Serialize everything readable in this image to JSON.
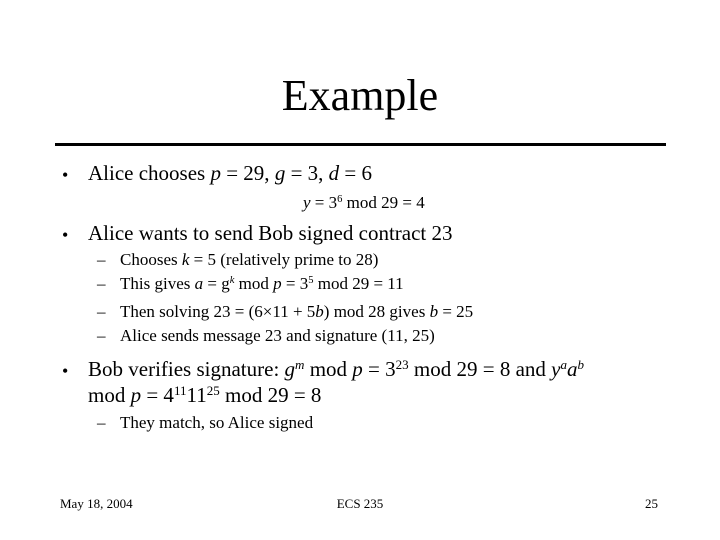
{
  "slide": {
    "title": "Example",
    "bullets": [
      {
        "segments": [
          {
            "t": "Alice chooses "
          },
          {
            "t": "p",
            "i": true
          },
          {
            "t": " = 29, "
          },
          {
            "t": "g",
            "i": true
          },
          {
            "t": " = 3, "
          },
          {
            "t": "d",
            "i": true
          },
          {
            "t": " = 6"
          }
        ],
        "note": [
          {
            "t": "y",
            "i": true
          },
          {
            "t": " = 3"
          },
          {
            "t": "6",
            "sup": true
          },
          {
            "t": " mod 29 = 4"
          }
        ]
      },
      {
        "segments": [
          {
            "t": "Alice wants to send Bob signed contract 23"
          }
        ],
        "subitems": [
          [
            {
              "t": "Chooses "
            },
            {
              "t": "k",
              "i": true
            },
            {
              "t": " = 5 (relatively prime to 28)"
            }
          ],
          [
            {
              "t": "This gives "
            },
            {
              "t": "a",
              "i": true
            },
            {
              "t": " = g"
            },
            {
              "t": "k",
              "sup": true,
              "i": true
            },
            {
              "t": " mod "
            },
            {
              "t": "p",
              "i": true
            },
            {
              "t": " = 3"
            },
            {
              "t": "5",
              "sup": true
            },
            {
              "t": " mod 29 = 11"
            }
          ],
          [
            {
              "t": "Then solving 23 = (6×11 + 5"
            },
            {
              "t": "b",
              "i": true
            },
            {
              "t": ") mod 28 gives "
            },
            {
              "t": "b",
              "i": true
            },
            {
              "t": " = 25"
            }
          ],
          [
            {
              "t": "Alice sends message 23 and signature (11, 25)"
            }
          ]
        ]
      },
      {
        "lines": [
          [
            {
              "t": "Bob verifies signature: "
            },
            {
              "t": "g",
              "i": true
            },
            {
              "t": "m",
              "sup": true,
              "i": true
            },
            {
              "t": " mod "
            },
            {
              "t": "p",
              "i": true
            },
            {
              "t": " = 3"
            },
            {
              "t": "23",
              "sup": true
            },
            {
              "t": " mod 29 = 8 and "
            },
            {
              "t": "y",
              "i": true
            },
            {
              "t": "a",
              "sup": true,
              "i": true
            },
            {
              "t": "a",
              "i": true
            },
            {
              "t": "b",
              "sup": true,
              "i": true
            }
          ],
          [
            {
              "t": "mod "
            },
            {
              "t": "p",
              "i": true
            },
            {
              "t": " = 4"
            },
            {
              "t": "11",
              "sup": true
            },
            {
              "t": "11"
            },
            {
              "t": "25",
              "sup": true
            },
            {
              "t": " mod 29 = 8"
            }
          ]
        ],
        "subitems": [
          [
            {
              "t": "They match, so Alice signed"
            }
          ]
        ]
      }
    ],
    "bullet_glyph": "•",
    "dash_glyph": "–"
  },
  "footer": {
    "date": "May 18, 2004",
    "course": "ECS 235",
    "page_number": "25"
  }
}
